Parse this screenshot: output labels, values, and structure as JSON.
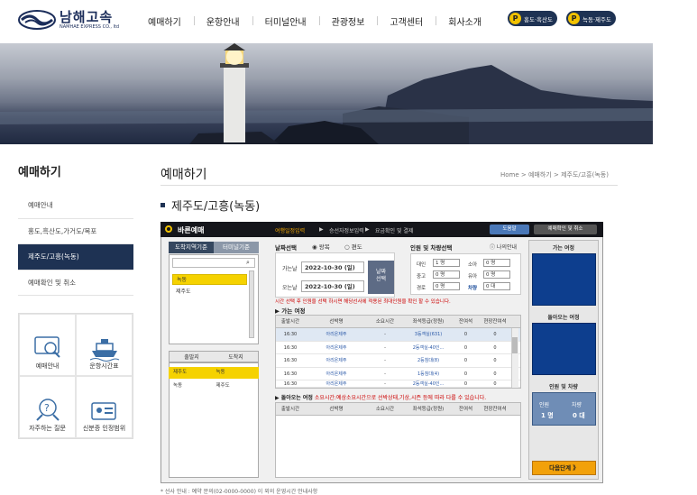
{
  "header": {
    "logo_ko": "남해고속",
    "logo_en": "NAMHAE EXPRESS CO., ltd",
    "nav": [
      "예매하기",
      "운항안내",
      "터미널안내",
      "관광정보",
      "고객센터",
      "회사소개"
    ],
    "pill1": "홍도·흑산도",
    "pill2": "녹동·제주도",
    "pill_mark": "P"
  },
  "sidebar": {
    "title": "예매하기",
    "items": [
      "예매안내",
      "홍도,흑산도,가거도/목포",
      "제주도/고흥(녹동)",
      "예매확인 및 취소"
    ],
    "grid": [
      "예매안내",
      "운항시간표",
      "자주하는 질문",
      "신분증 인정범위"
    ]
  },
  "content": {
    "title": "예매하기",
    "breadcrumb": "Home  >  예매하기  >  제주도/고흥(녹동)",
    "subtitle": "제주도/고흥(녹동)"
  },
  "widget": {
    "brand": "바른예매",
    "steps": [
      "여행일정입력",
      "승선자정보입력",
      "요금확인 및 결제"
    ],
    "help_btn": "도움말",
    "check_btn": "예매확인 및 취소",
    "tab1": "도착지역기준",
    "tab2": "터미널기준",
    "regions": [
      "녹동",
      "제주도"
    ],
    "col_depart": "출발지",
    "col_arrive": "도착지",
    "routes": [
      [
        "제주도",
        "녹동"
      ],
      [
        "녹동",
        "제주도"
      ]
    ],
    "date_label": "날짜선택",
    "roundtrip": "왕복",
    "oneway": "편도",
    "go_label": "가는날",
    "go_date": "2022-10-30 (일)",
    "back_label": "오는날",
    "back_date": "2022-10-30 (일)",
    "search_btn": "날짜\n선택",
    "people_label": "인원 및 차량선택",
    "my_info": "나의안내",
    "ppl": [
      {
        "label": "대인",
        "value": "1 명"
      },
      {
        "label": "소아",
        "value": "0 명"
      },
      {
        "label": "중고",
        "value": "0 명"
      },
      {
        "label": "유아",
        "value": "0 명"
      },
      {
        "label": "경로",
        "value": "0 명"
      },
      {
        "label": "차량",
        "value": "0 대"
      }
    ],
    "notice1": "시간 선택 후 인원을 선택 하시면 해당선사에 적용된 최대인원을 확인 할 수 있습니다.",
    "go_trip": "가는 여정",
    "back_trip": "돌아오는 여정",
    "notice2": "소요시간:예상소요시간으로 선박상태,기상,시즌 등에 따라 다를 수 있습니다.",
    "columns": [
      "출발시간",
      "선박명",
      "소요시간",
      "좌석등급(정원)",
      "잔여석",
      "현장잔여석"
    ],
    "rows": [
      [
        "16:30",
        "아리온제주",
        "-",
        "3등객실(631)",
        "0",
        "0"
      ],
      [
        "16:30",
        "아리온제주",
        "-",
        "2등객실-40인...",
        "0",
        "0"
      ],
      [
        "16:30",
        "아리온제주",
        "-",
        "2등침대(8)",
        "0",
        "0"
      ],
      [
        "16:30",
        "아리온제주",
        "-",
        "1등침대(4)",
        "0",
        "0"
      ],
      [
        "16:30",
        "아리온제주",
        "-",
        "2등객실-40인...",
        "0",
        "0"
      ]
    ],
    "side_go": "가는 여정",
    "side_back": "돌아오는 여정",
    "side_people": "인원 및 차량",
    "side_ppl_label": "인원",
    "side_ppl_val": "1 명",
    "side_car_label": "차량",
    "side_car_val": "0 대",
    "next_btn": "다음단계 》"
  },
  "footer": "* 선사 안내 : 예약 문의(02-0000-0000) 이 외의 운영시간 안내사항"
}
